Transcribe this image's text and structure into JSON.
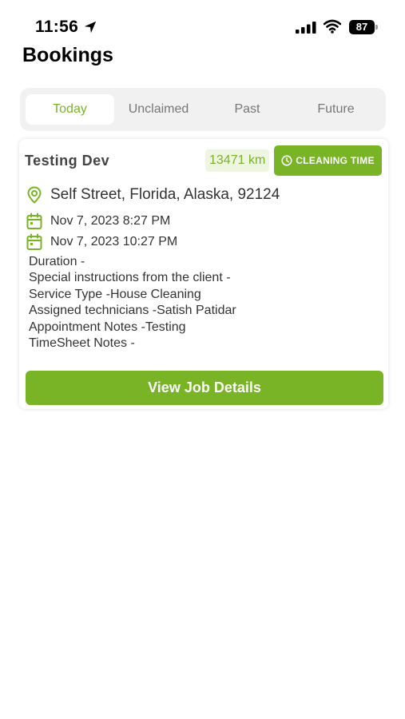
{
  "status_bar": {
    "time": "11:56",
    "battery": "87"
  },
  "header": {
    "title": "Bookings"
  },
  "tabs": [
    {
      "label": "Today",
      "active": true
    },
    {
      "label": "Unclaimed",
      "active": false
    },
    {
      "label": "Past",
      "active": false
    },
    {
      "label": "Future",
      "active": false
    }
  ],
  "booking": {
    "client_name": "Testing Dev",
    "distance": "13471 km",
    "cleaning_time_label": "CLEANING TIME",
    "address": "Self Street, Florida, Alaska, 92124",
    "start": "Nov 7, 2023 8:27 PM",
    "end": "Nov 7, 2023 10:27 PM",
    "details": [
      "Duration -",
      "Special instructions from the client -",
      "Service Type -House Cleaning",
      "Assigned technicians -Satish Patidar",
      "Appointment Notes -Testing",
      "TimeSheet Notes -"
    ],
    "view_button": "View Job Details"
  },
  "colors": {
    "accent": "#78b426",
    "accent_light": "#eef6e2",
    "tab_active_text": "#7ab32a"
  },
  "icons": [
    "location-arrow-icon",
    "signal-icon",
    "wifi-icon",
    "battery-icon",
    "clock-icon",
    "map-pin-icon",
    "calendar-icon"
  ]
}
